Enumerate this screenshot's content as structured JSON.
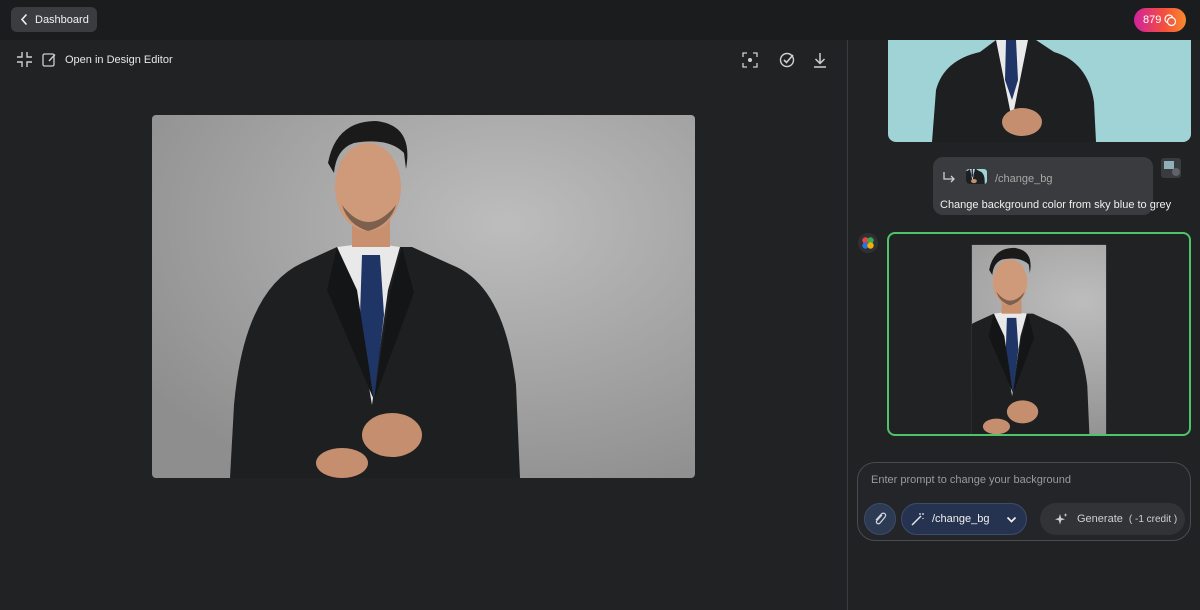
{
  "topbar": {
    "back_label": "Dashboard",
    "credits": "879"
  },
  "toolbar": {
    "open_editor_label": "Open in Design Editor",
    "icons": [
      "collapse-icon",
      "edit-icon",
      "focus-icon",
      "compare-icon",
      "download-icon"
    ]
  },
  "chat": {
    "user_message": {
      "command": "/change_bg",
      "text": "Change background color from sky blue to grey"
    }
  },
  "prompt": {
    "placeholder": "Enter prompt to change your background",
    "selected_command": "/change_bg",
    "generate_label": "Generate",
    "cost_label": "( -1 credit )"
  },
  "colors": {
    "background": "#212224",
    "topbar": "#1b1c1e",
    "result_border": "#4ec46a",
    "credit_gradient_start": "#d1229e",
    "credit_gradient_end": "#f88b2a"
  }
}
